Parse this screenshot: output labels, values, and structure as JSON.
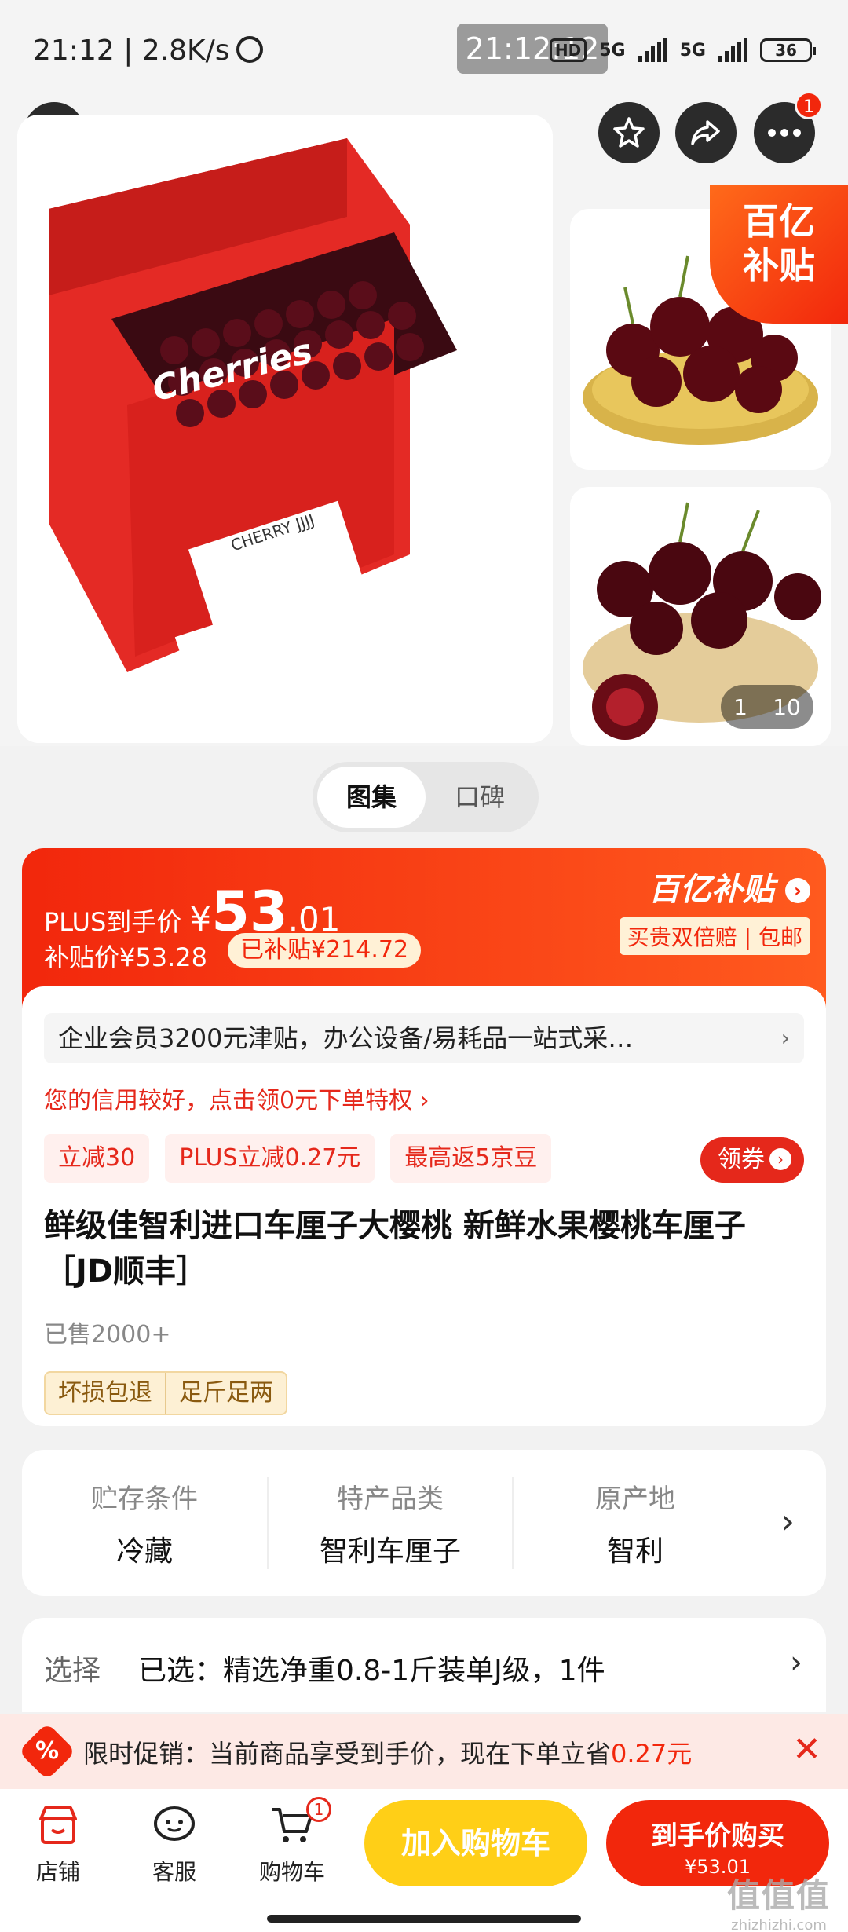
{
  "status_bar": {
    "time": "21:12 | 2.8K/s",
    "clock_overlay": "21:12:12",
    "hd": "HD",
    "net1": "5G",
    "net2": "5G",
    "battery": "36"
  },
  "nav": {
    "more_badge": "1"
  },
  "gallery": {
    "corner_badge_line1": "百亿",
    "corner_badge_line2": "补贴",
    "counter_current": "1",
    "counter_total": "10",
    "box_label": "Cherries",
    "box_brand": "CHERRY JJJJ"
  },
  "tabs": [
    "图集",
    "口碑"
  ],
  "price": {
    "label": "PLUS到手价",
    "yen": "¥",
    "integer": "53",
    "decimal": ".01",
    "subsidy_price": "补贴价¥53.28",
    "subsidied": "已补贴¥214.72",
    "brand": "百亿补贴",
    "guarantee": "买贵双倍赔 | 包邮"
  },
  "info": {
    "enterprise": "企业会员3200元津贴，办公设备/易耗品一站式采…",
    "enterprise_arrow": "›",
    "credit": "您的信用较好，点击领0元下单特权 ›",
    "promos": [
      "立减30",
      "PLUS立减0.27元",
      "最高返5京豆"
    ],
    "coupon": "领券",
    "title": "鲜级佳智利进口车厘子大樱桃 新鲜水果樱桃车厘子［JD顺丰］",
    "sold": "已售2000+",
    "services": [
      "坏损包退",
      "足斤足两"
    ]
  },
  "specs": [
    {
      "key": "贮存条件",
      "value": "冷藏"
    },
    {
      "key": "特产品类",
      "value": "智利车厘子"
    },
    {
      "key": "原产地",
      "value": "智利"
    }
  ],
  "select": {
    "label": "选择",
    "value": "已选：精选净重0.8-1斤装单J级，1件"
  },
  "promo_strip": {
    "text": "限时促销：当前商品享受到手价，现在下单立省",
    "saving": "0.27元",
    "icon": "%"
  },
  "bottom": {
    "shop": "店铺",
    "service": "客服",
    "cart": "购物车",
    "cart_badge": "1",
    "add_cart": "加入购物车",
    "buy_line1": "到手价购买",
    "buy_line2": "¥53.01"
  },
  "watermark": {
    "site": "zhizhizhi.com",
    "glyph": "值值值"
  },
  "colors": {
    "accent": "#f2270c",
    "cart_button": "#ffcf17",
    "nav_button": "#2b2b2b"
  }
}
